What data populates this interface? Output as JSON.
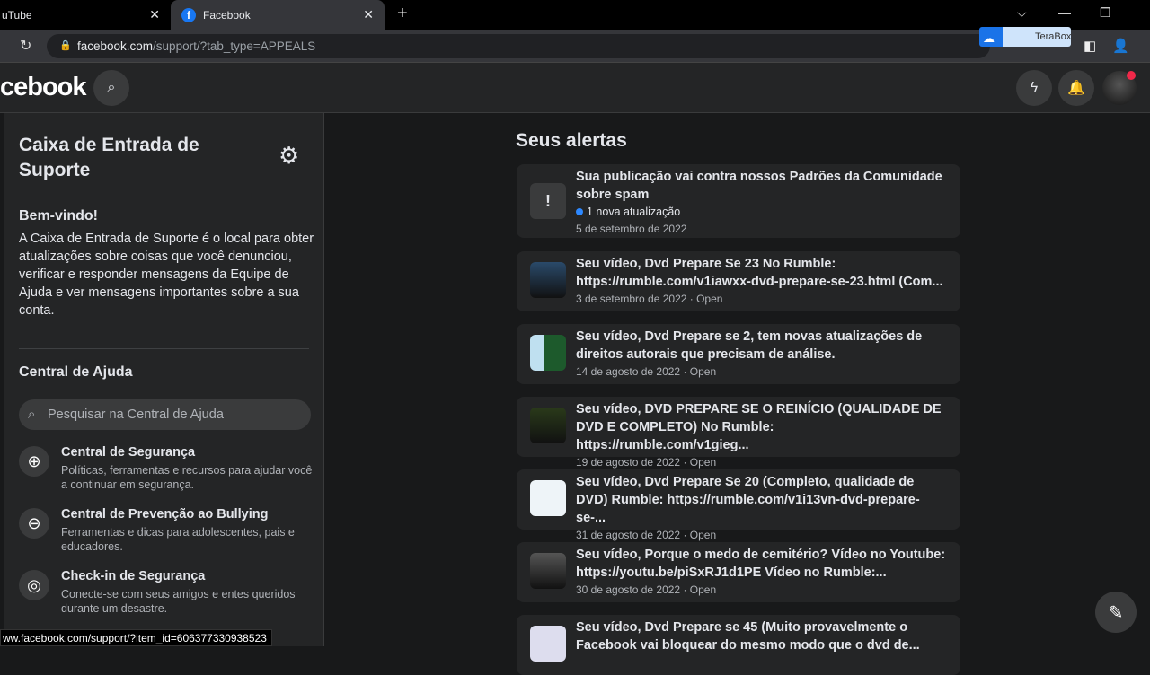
{
  "browser": {
    "tabs": [
      {
        "label": "uTube"
      },
      {
        "label": "Facebook"
      }
    ],
    "url_host": "facebook.com",
    "url_path": "/support/?tab_type=APPEALS",
    "terabox": "TeraBox",
    "status_url": "ww.facebook.com/support/?item_id=606377330938523"
  },
  "header": {
    "logo": "cebook"
  },
  "sidebar": {
    "title": "Caixa de Entrada de Suporte",
    "welcome_title": "Bem-vindo!",
    "welcome_text": "A Caixa de Entrada de Suporte é o local para obter atualizações sobre coisas que você denunciou, verificar e responder mensagens da Equipe de Ajuda e ver mensagens importantes sobre a sua conta.",
    "help_title": "Central de Ajuda",
    "search_placeholder": "Pesquisar na Central de Ajuda",
    "items": [
      {
        "title": "Central de Segurança",
        "desc": "Políticas, ferramentas e recursos para ajudar você a continuar em segurança."
      },
      {
        "title": "Central de Prevenção ao Bullying",
        "desc": "Ferramentas e dicas para adolescentes, pais e educadores."
      },
      {
        "title": "Check-in de Segurança",
        "desc": "Conecte-se com seus amigos e entes queridos durante um desastre."
      }
    ]
  },
  "main": {
    "title": "Seus alertas",
    "alerts": [
      {
        "title": "Sua publicação vai contra nossos Padrões da Comunidade sobre spam",
        "update": "1 nova atualização",
        "meta": "5 de setembro de 2022"
      },
      {
        "title": "Seu vídeo, Dvd Prepare Se 23 No Rumble: https://rumble.com/v1iawxx-dvd-prepare-se-23.html (Com...",
        "meta": "3 de setembro de 2022 · Open"
      },
      {
        "title": "Seu vídeo, Dvd Prepare se 2, tem novas atualizações de direitos autorais que precisam de análise.",
        "meta": "14 de agosto de 2022 · Open"
      },
      {
        "title": "Seu vídeo, DVD PREPARE SE O REINÍCIO (QUALIDADE DE DVD E COMPLETO) No Rumble: https://rumble.com/v1gieg...",
        "meta": "19 de agosto de 2022 · Open"
      },
      {
        "title": "Seu vídeo, Dvd Prepare Se 20 (Completo, qualidade de DVD) Rumble: https://rumble.com/v1i13vn-dvd-prepare-se-...",
        "meta": "31 de agosto de 2022 · Open"
      },
      {
        "title": "Seu vídeo, Porque o medo de cemitério? Vídeo no Youtube: https://youtu.be/piSxRJ1d1PE Vídeo no Rumble:...",
        "meta": "30 de agosto de 2022 · Open"
      },
      {
        "title": "Seu vídeo, Dvd Prepare se 45 (Muito provavelmente o Facebook vai bloquear do mesmo modo que o dvd de..."
      }
    ]
  }
}
